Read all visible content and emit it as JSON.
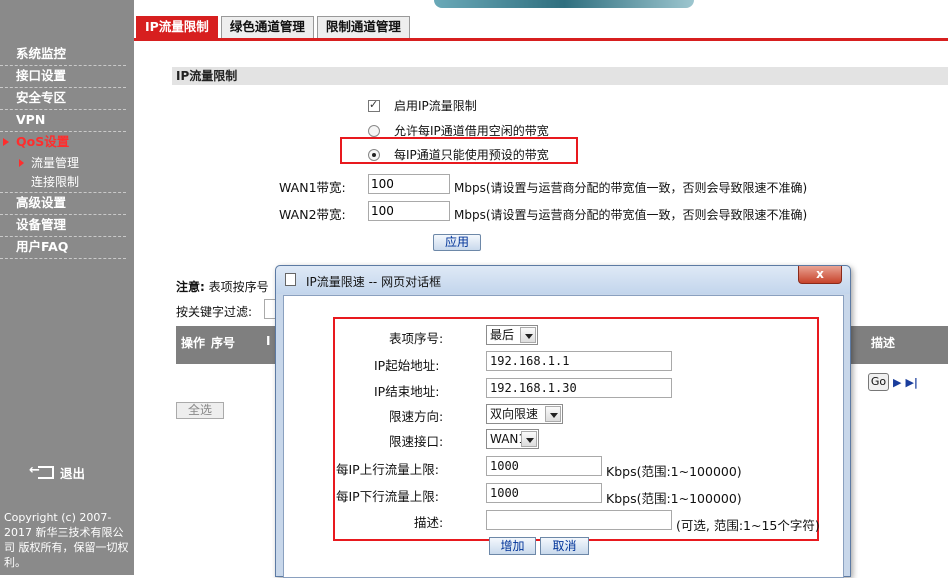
{
  "sidebar": {
    "items": [
      {
        "label": "系统监控"
      },
      {
        "label": "接口设置"
      },
      {
        "label": "安全专区"
      },
      {
        "label": "VPN"
      },
      {
        "label": "QoS设置"
      },
      {
        "label": "高级设置"
      },
      {
        "label": "设备管理"
      },
      {
        "label": "用户FAQ"
      }
    ],
    "sub_items": [
      {
        "label": "流量管理"
      },
      {
        "label": "连接限制"
      }
    ],
    "logout": "退出",
    "copyright": "Copyright (c) 2007-2017 新华三技术有限公司 版权所有，保留一切权利。"
  },
  "tabs": [
    {
      "label": "IP流量限制"
    },
    {
      "label": "绿色通道管理"
    },
    {
      "label": "限制通道管理"
    }
  ],
  "main": {
    "section_title": "IP流量限制",
    "enable_label": "启用IP流量限制",
    "radio1_label": "允许每IP通道借用空闲的带宽",
    "radio2_label": "每IP通道只能使用预设的带宽",
    "wan1_label": "WAN1带宽:",
    "wan1_value": "100",
    "wan2_label": "WAN2带宽:",
    "wan2_value": "100",
    "wan_note": "Mbps(请设置与运营商分配的带宽值一致，否则会导致限速不准确)",
    "apply_label": "应用",
    "notice_label": "注意:",
    "notice_text": "表项按序号",
    "filter_label": "按关键字过滤:",
    "table_headers": [
      "操作",
      "序号",
      "I",
      "描述"
    ],
    "select_all": "全选",
    "go": "Go",
    "next": "▶",
    "last": "▶|"
  },
  "dialog": {
    "title": "IP流量限速 -- 网页对话框",
    "close": "x",
    "seq_label": "表项序号:",
    "seq_value": "最后",
    "start_ip_label": "IP起始地址:",
    "start_ip": "192.168.1.1",
    "end_ip_label": "IP结束地址:",
    "end_ip": "192.168.1.30",
    "direction_label": "限速方向:",
    "direction_value": "双向限速",
    "iface_label": "限速接口:",
    "iface_value": "WAN1",
    "up_label": "每IP上行流量上限:",
    "up_value": "1000",
    "up_unit": "Kbps(范围:1~100000)",
    "down_label": "每IP下行流量上限:",
    "down_value": "1000",
    "down_unit": "Kbps(范围:1~100000)",
    "desc_label": "描述:",
    "desc_value": "",
    "desc_note": "(可选, 范围:1~15个字符)",
    "add_label": "增加",
    "cancel_label": "取消"
  }
}
